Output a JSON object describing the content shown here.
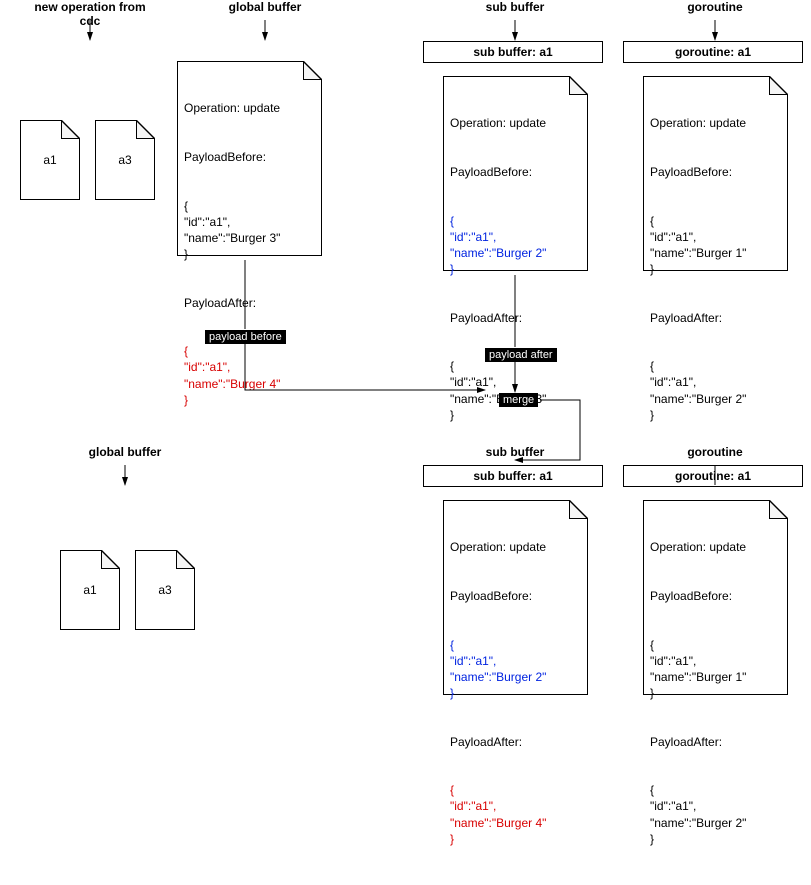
{
  "section_titles": {
    "new_op": "new operation from cdc",
    "global_buf": "global buffer",
    "sub_buf": "sub buffer",
    "goroutine": "goroutine"
  },
  "tabs": {
    "sub_top": "sub buffer: a1",
    "gor_top": "goroutine: a1",
    "sub_bot": "sub buffer: a1",
    "gor_bot": "goroutine: a1"
  },
  "small_notes": {
    "a1": "a1",
    "a3": "a3"
  },
  "labels": {
    "payload_before": "payload before",
    "payload_after": "payload after",
    "merge": "merge"
  },
  "payloads": {
    "new_op": {
      "op": "Operation: update",
      "pb_label": "PayloadBefore:",
      "pb_body": "{\n\"id\":\"a1\",\n\"name\":\"Burger 3\"\n}",
      "pa_label": "PayloadAfter:",
      "pa_body": "{\n\"id\":\"a1\",\n\"name\":\"Burger 4\"\n}"
    },
    "sub_top": {
      "op": "Operation: update",
      "pb_label": "PayloadBefore:",
      "pb_body": "{\n\"id\":\"a1\",\n\"name\":\"Burger 2\"\n}",
      "pa_label": "PayloadAfter:",
      "pa_body": "{\n\"id\":\"a1\",\n\"name\":\"Burger 3\"\n}"
    },
    "gor_top": {
      "op": "Operation: update",
      "pb_label": "PayloadBefore:",
      "pb_body": "{\n\"id\":\"a1\",\n\"name\":\"Burger 1\"\n}",
      "pa_label": "PayloadAfter:",
      "pa_body": "{\n\"id\":\"a1\",\n\"name\":\"Burger 2\"\n}"
    },
    "sub_bot": {
      "op": "Operation: update",
      "pb_label": "PayloadBefore:",
      "pb_body": "{\n\"id\":\"a1\",\n\"name\":\"Burger 2\"\n}",
      "pa_label": "PayloadAfter:",
      "pa_body": "{\n\"id\":\"a1\",\n\"name\":\"Burger 4\"\n}"
    },
    "gor_bot": {
      "op": "Operation: update",
      "pb_label": "PayloadBefore:",
      "pb_body": "{\n\"id\":\"a1\",\n\"name\":\"Burger 1\"\n}",
      "pa_label": "PayloadAfter:",
      "pa_body": "{\n\"id\":\"a1\",\n\"name\":\"Burger 2\"\n}"
    }
  }
}
